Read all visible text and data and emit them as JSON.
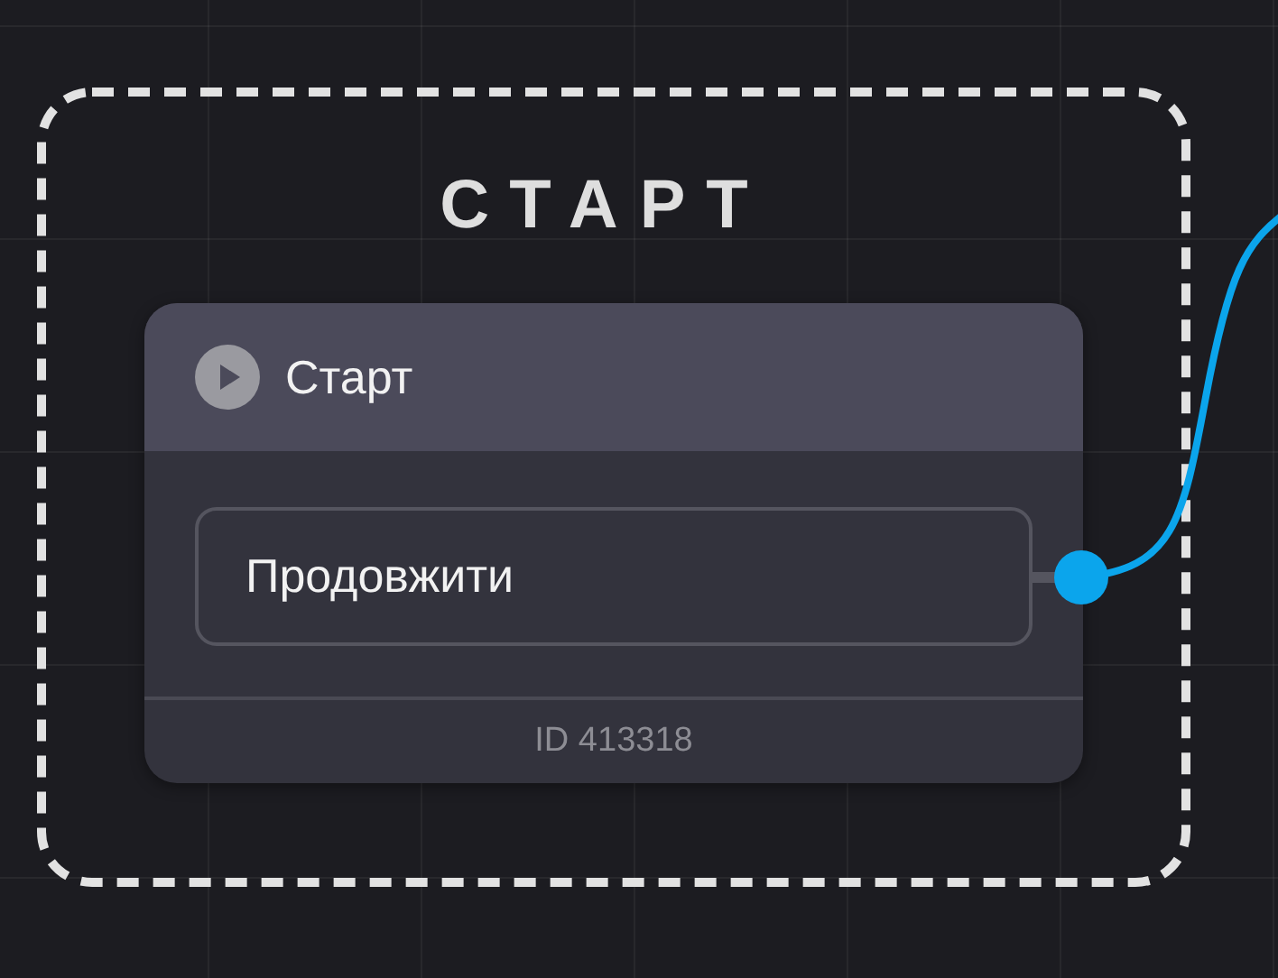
{
  "group": {
    "title": "СТАРТ"
  },
  "node": {
    "title": "Старт",
    "outputs": [
      {
        "label": "Продовжити",
        "connected": true
      }
    ],
    "footer": "ID 413318"
  }
}
